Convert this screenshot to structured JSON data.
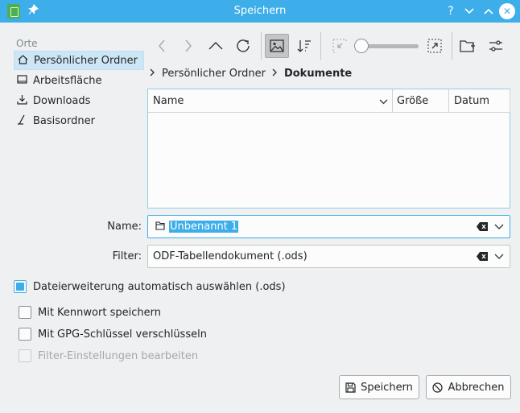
{
  "window": {
    "title": "Speichern"
  },
  "places": {
    "heading": "Orte",
    "items": [
      {
        "label": "Persönlicher Ordner",
        "icon": "home-icon",
        "selected": true
      },
      {
        "label": "Arbeitsfläche",
        "icon": "desktop-icon",
        "selected": false
      },
      {
        "label": "Downloads",
        "icon": "download-icon",
        "selected": false
      },
      {
        "label": "Basisordner",
        "icon": "root-folder-icon",
        "selected": false
      }
    ]
  },
  "breadcrumb": {
    "parent": "Persönlicher Ordner",
    "current": "Dokumente"
  },
  "filelist": {
    "columns": [
      "Name",
      "Größe",
      "Datum"
    ]
  },
  "name_field": {
    "label": "Name:",
    "value": "Unbenannt 1"
  },
  "filter_field": {
    "label": "Filter:",
    "value": "ODF-Tabellendokument (.ods)"
  },
  "auto_extension": {
    "label": "Dateierweiterung automatisch auswählen (.ods)",
    "checked": true
  },
  "options": [
    {
      "label": "Mit Kennwort speichern",
      "checked": false,
      "disabled": false
    },
    {
      "label": "Mit GPG-Schlüssel verschlüsseln",
      "checked": false,
      "disabled": false
    },
    {
      "label": "Filter-Einstellungen bearbeiten",
      "checked": false,
      "disabled": true
    }
  ],
  "buttons": {
    "save": "Speichern",
    "cancel": "Abbrechen"
  },
  "colors": {
    "accent": "#3daee9",
    "background": "#eff0f1",
    "selection": "#cde6f6"
  }
}
